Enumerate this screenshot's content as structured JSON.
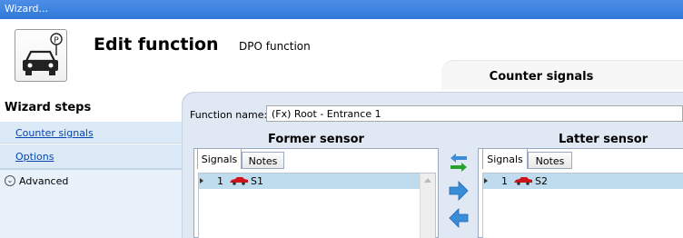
{
  "window": {
    "title": "Wizard..."
  },
  "header": {
    "title": "Edit function",
    "subtitle": "DPO function",
    "icon": "parking-car-icon"
  },
  "top_tab": {
    "label": "Counter signals"
  },
  "sidebar": {
    "heading": "Wizard steps",
    "items": [
      {
        "label": "Counter signals"
      },
      {
        "label": "Options"
      }
    ],
    "advanced": {
      "label": "Advanced",
      "icon": "expand-circle-icon"
    }
  },
  "function_name": {
    "label": "Function name:",
    "value": "(Fx) Root - Entrance 1"
  },
  "former": {
    "title": "Former sensor",
    "tabs": [
      {
        "label": "Signals"
      },
      {
        "label": "Notes"
      }
    ],
    "rows": [
      {
        "index": "1",
        "signal": "S1"
      }
    ]
  },
  "latter": {
    "title": "Latter sensor",
    "tabs": [
      {
        "label": "Signals"
      },
      {
        "label": "Notes"
      }
    ],
    "rows": [
      {
        "index": "1",
        "signal": "S2"
      }
    ]
  },
  "colors": {
    "titlebar": "#3a80dd",
    "selected_row": "#bfdcee",
    "sidebar_item": "#dceaf7",
    "main_bg": "#dfe8f3",
    "car_red": "#d0131b",
    "arrow_blue": "#3a8ed8",
    "arrow_green": "#2aa12e"
  }
}
